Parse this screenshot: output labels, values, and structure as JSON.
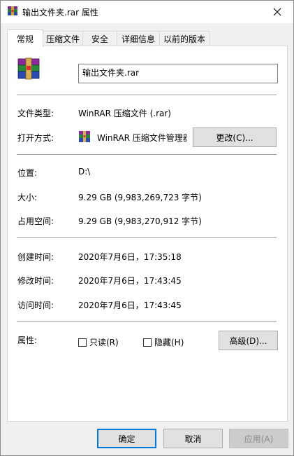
{
  "window": {
    "title": "输出文件夹.rar 属性",
    "close_glyph": "✕"
  },
  "tabs": [
    "常规",
    "压缩文件",
    "安全",
    "详细信息",
    "以前的版本"
  ],
  "general": {
    "file_name": "输出文件夹.rar",
    "type_label": "文件类型:",
    "type_value": "WinRAR 压缩文件 (.rar)",
    "open_label": "打开方式:",
    "open_value": "WinRAR 压缩文件管理器",
    "change_button": "更改(C)...",
    "location_label": "位置:",
    "location_value": "D:\\",
    "size_label": "大小:",
    "size_value": "9.29 GB (9,983,269,723 字节)",
    "disk_label": "占用空间:",
    "disk_value": "9.29 GB (9,983,270,912 字节)",
    "created_label": "创建时间:",
    "created_value": "2020年7月6日，17:35:18",
    "modified_label": "修改时间:",
    "modified_value": "2020年7月6日，17:43:45",
    "accessed_label": "访问时间:",
    "accessed_value": "2020年7月6日，17:43:45",
    "attributes_label": "属性:",
    "readonly_label": "只读(R)",
    "hidden_label": "隐藏(H)",
    "advanced_button": "高级(D)..."
  },
  "footer": {
    "ok": "确定",
    "cancel": "取消",
    "apply": "应用(A)"
  },
  "icons": {
    "winrar": "winrar-archive-icon"
  },
  "colors": {
    "accent": "#0078d7",
    "panel": "#ffffff",
    "window": "#f0f0f0"
  }
}
